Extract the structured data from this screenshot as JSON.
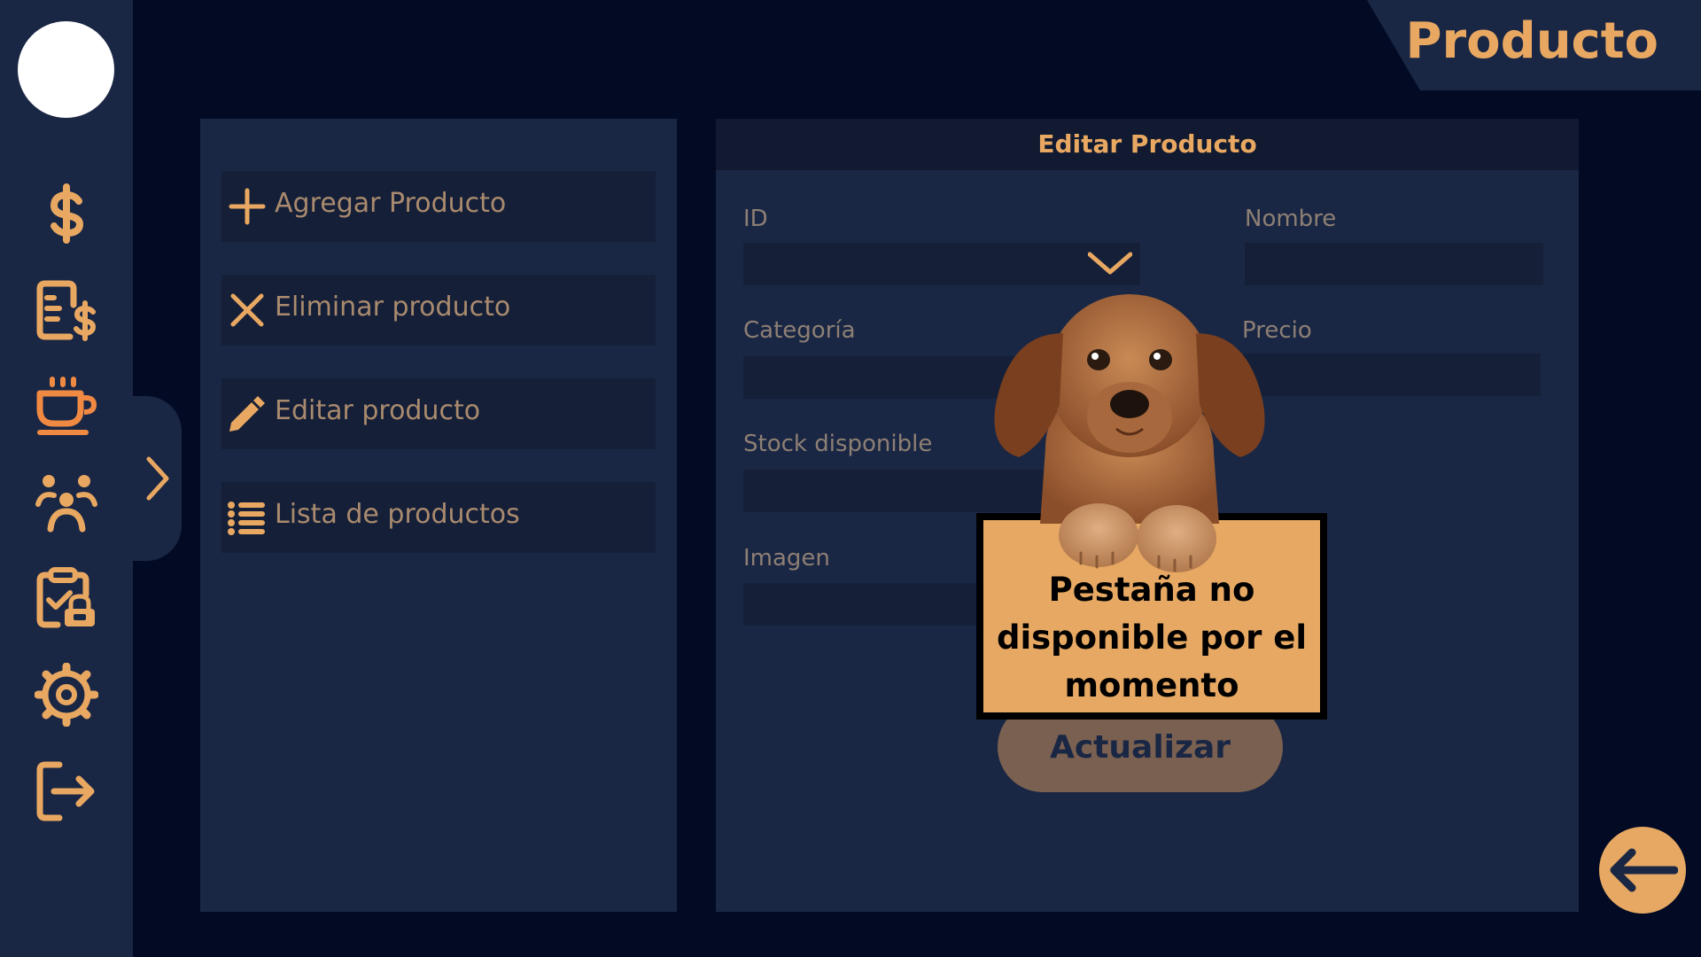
{
  "page": {
    "title": "Producto"
  },
  "sidebar": {
    "icons": [
      "dollar-icon",
      "invoice-icon",
      "coffee-icon",
      "people-icon",
      "clipboard-lock-icon",
      "gear-icon",
      "logout-icon"
    ],
    "active": "coffee-icon"
  },
  "menu": {
    "items": [
      {
        "icon": "plus-icon",
        "label": "Agregar Producto"
      },
      {
        "icon": "close-icon",
        "label": "Eliminar producto"
      },
      {
        "icon": "pencil-icon",
        "label": "Editar producto"
      },
      {
        "icon": "list-icon",
        "label": "Lista de productos"
      }
    ]
  },
  "form": {
    "title": "Editar Producto",
    "fields": {
      "id": {
        "label": "ID",
        "value": ""
      },
      "nombre": {
        "label": "Nombre",
        "value": ""
      },
      "categoria": {
        "label": "Categoría",
        "value": ""
      },
      "precio": {
        "label": "Precio",
        "value": ""
      },
      "stock": {
        "label": "Stock disponible",
        "value": ""
      },
      "imagen": {
        "label": "Imagen",
        "value": ""
      }
    },
    "update_label": "Actualizar"
  },
  "overlay": {
    "message": "Pestaña no disponible por el momento",
    "image": "puppy-illustration"
  },
  "colors": {
    "accent": "#e9a862",
    "background": "#030b24",
    "panel": "#1a2744",
    "field": "#152038",
    "active_icon": "#f08a43"
  }
}
